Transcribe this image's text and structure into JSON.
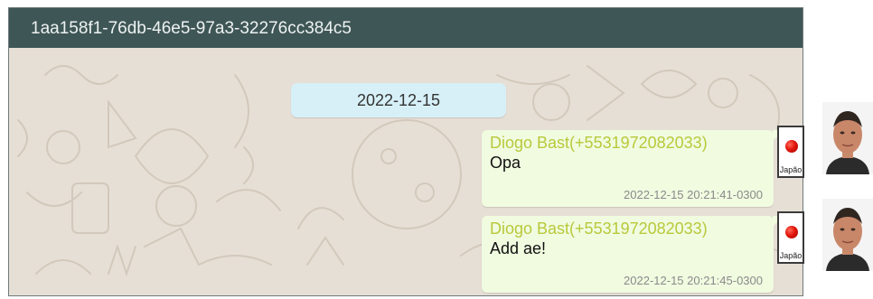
{
  "chat": {
    "title": "1aa158f1-76db-46e5-97a3-32276cc384c5",
    "date_separator": "2022-12-15",
    "messages": [
      {
        "sender": "Diogo Bast(+5531972082033)",
        "text": "Opa",
        "timestamp": "2022-12-15 20:21:41-0300",
        "country": "Japão"
      },
      {
        "sender": "Diogo Bast(+5531972082033)",
        "text": "Add ae!",
        "timestamp": "2022-12-15 20:21:45-0300",
        "country": "Japão"
      }
    ]
  },
  "colors": {
    "header_bg": "#3f5656",
    "bubble_bg": "#f0fbe0",
    "sender_color": "#b9c93a",
    "date_pill_bg": "#d7f0f8",
    "flag_red": "#e3160c"
  },
  "icons": {
    "country_flag": "japan-flag-icon",
    "avatar": "user-avatar"
  }
}
